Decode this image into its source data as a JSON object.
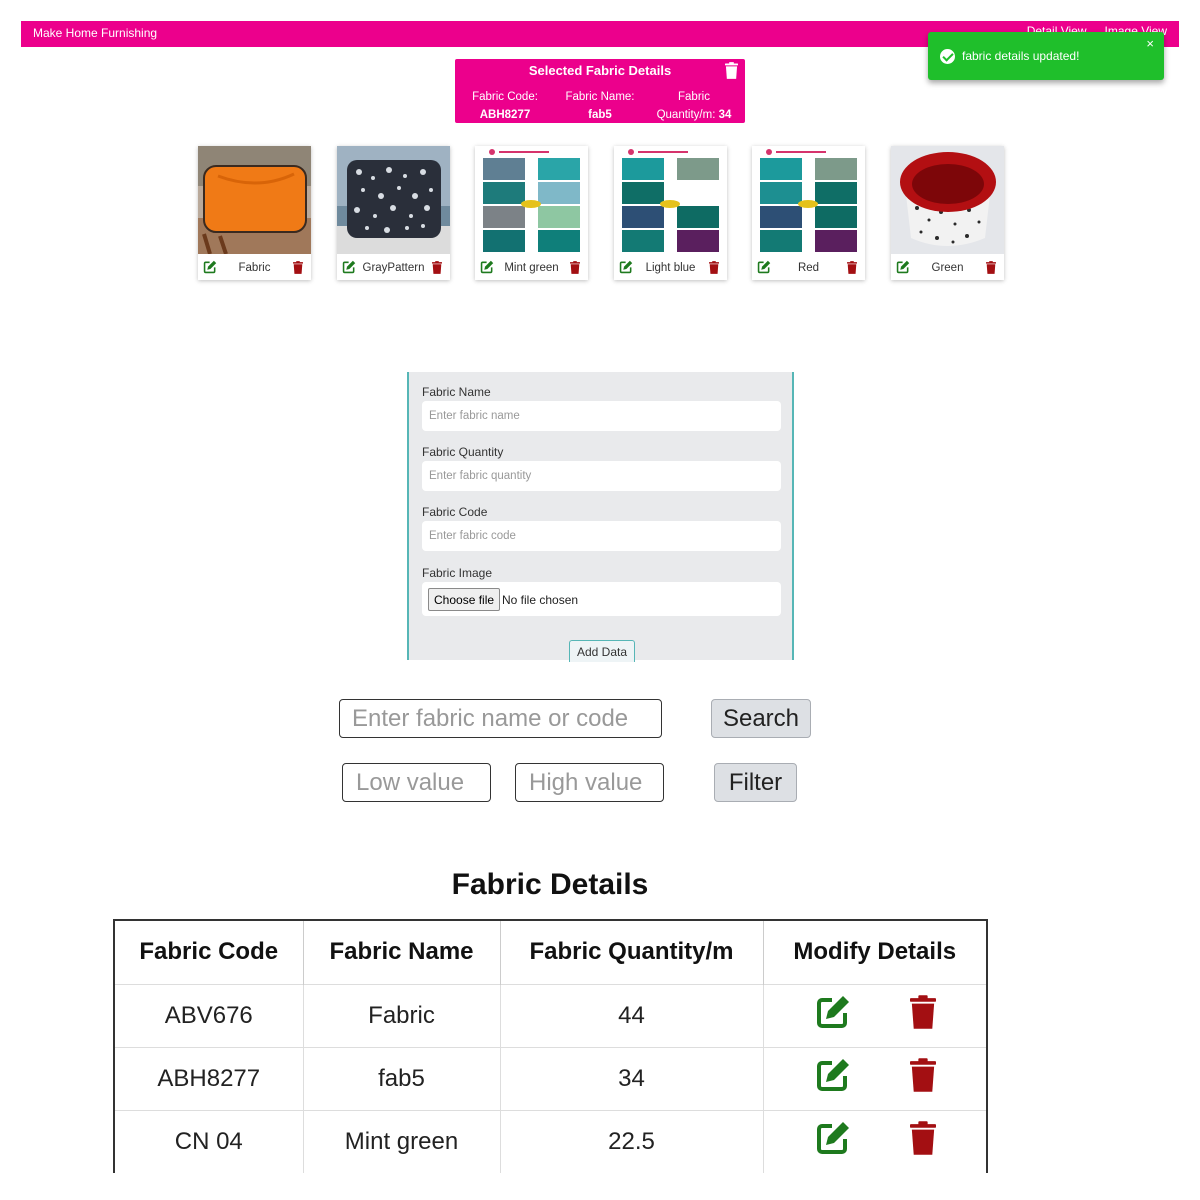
{
  "navbar": {
    "brand": "Make Home Furnishing",
    "links": [
      "Detail View",
      "Image View"
    ],
    "color": "#ec008c"
  },
  "toast": {
    "message": "fabric details updated!",
    "close": "×",
    "color": "#1fbf2b"
  },
  "selected": {
    "title": "Selected Fabric Details",
    "code_label": "Fabric Code:",
    "code_value": "ABH8277",
    "name_label": "Fabric Name:",
    "name_value": "fab5",
    "qty_label_1": "Fabric",
    "qty_label_2": "Quantity/m:",
    "qty_value": "34"
  },
  "gallery": [
    {
      "label": "Fabric",
      "image": "orange-cushion"
    },
    {
      "label": "GrayPattern",
      "image": "gray-pattern-cushion"
    },
    {
      "label": "Mint green",
      "image": "fabric-catalog"
    },
    {
      "label": "Light blue",
      "image": "fabric-catalog"
    },
    {
      "label": "Red",
      "image": "fabric-catalog"
    },
    {
      "label": "Green",
      "image": "red-basket"
    }
  ],
  "form": {
    "name_label": "Fabric Name",
    "name_placeholder": "Enter fabric name",
    "qty_label": "Fabric Quantity",
    "qty_placeholder": "Enter fabric quantity",
    "code_label": "Fabric Code",
    "code_placeholder": "Enter fabric code",
    "image_label": "Fabric Image",
    "file_button": "Choose file",
    "file_status": "No file chosen",
    "submit": "Add Data"
  },
  "search": {
    "placeholder": "Enter fabric name or code",
    "button": "Search"
  },
  "filter": {
    "low_placeholder": "Low value",
    "high_placeholder": "High value",
    "button": "Filter"
  },
  "table": {
    "title": "Fabric Details",
    "headers": [
      "Fabric Code",
      "Fabric Name",
      "Fabric Quantity/m",
      "Modify Details"
    ],
    "rows": [
      {
        "code": "ABV676",
        "name": "Fabric",
        "qty": "44"
      },
      {
        "code": "ABH8277",
        "name": "fab5",
        "qty": "34"
      },
      {
        "code": "CN 04",
        "name": "Mint green",
        "qty": "22.5"
      }
    ]
  },
  "icons": {
    "edit": "edit-icon",
    "delete": "trash-icon",
    "edit_color": "#1e7a1e",
    "delete_color": "#a30f12"
  }
}
